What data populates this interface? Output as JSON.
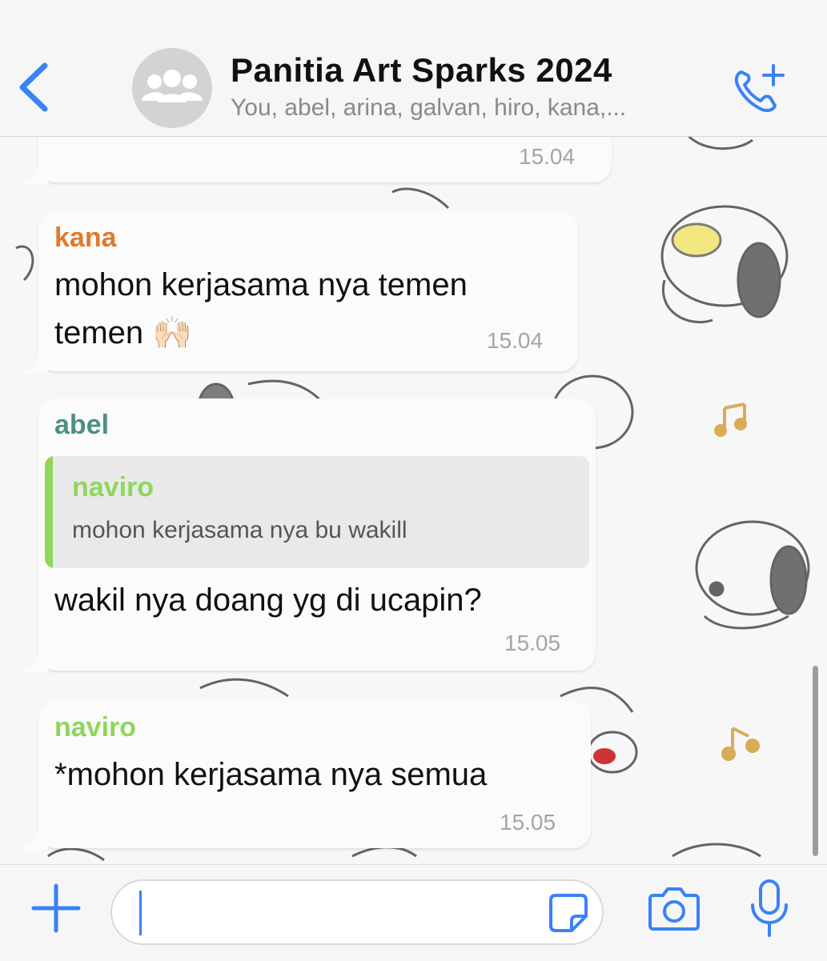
{
  "header": {
    "title": "Panitia Art Sparks 2024",
    "subtitle": "You, abel, arina, galvan, hiro, kana,..."
  },
  "messages": [
    {
      "time": "15.04"
    },
    {
      "sender": "kana",
      "sender_color": "#e07a2c",
      "line1": "mohon kerjasama nya temen",
      "line2": "temen 🙌🏻",
      "time": "15.04"
    },
    {
      "sender": "abel",
      "sender_color": "#4e8f84",
      "quote_sender": "naviro",
      "quote_text": "mohon kerjasama nya bu wakill",
      "text": "wakil nya doang yg di ucapin?",
      "time": "15.05"
    },
    {
      "sender": "naviro",
      "sender_color": "#8fd65a",
      "text": "*mohon kerjasama nya semua",
      "time": "15.05"
    }
  ],
  "composer": {
    "value": "",
    "placeholder": ""
  },
  "colors": {
    "accent": "#3a82f7"
  },
  "icons": [
    "back-chevron-icon",
    "group-avatar-icon",
    "add-call-icon",
    "plus-icon",
    "sticker-icon",
    "camera-icon",
    "microphone-icon"
  ]
}
